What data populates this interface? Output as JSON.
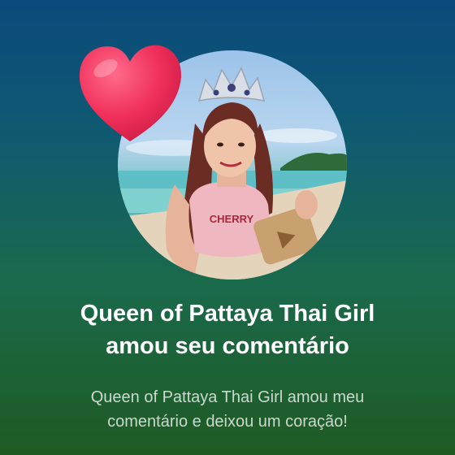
{
  "notification": {
    "title_line1": "Queen of Pattaya Thai Girl",
    "title_line2": "amou seu comentário",
    "message_line1": "Queen of Pattaya Thai Girl amou meu",
    "message_line2": "comentário e deixou um coração!",
    "avatar_shirt_text": "CHERRY",
    "heart_icon": "heart-icon",
    "colors": {
      "heart": "#f0305a",
      "title": "#ffffff",
      "message": "#c9d9cf"
    }
  }
}
